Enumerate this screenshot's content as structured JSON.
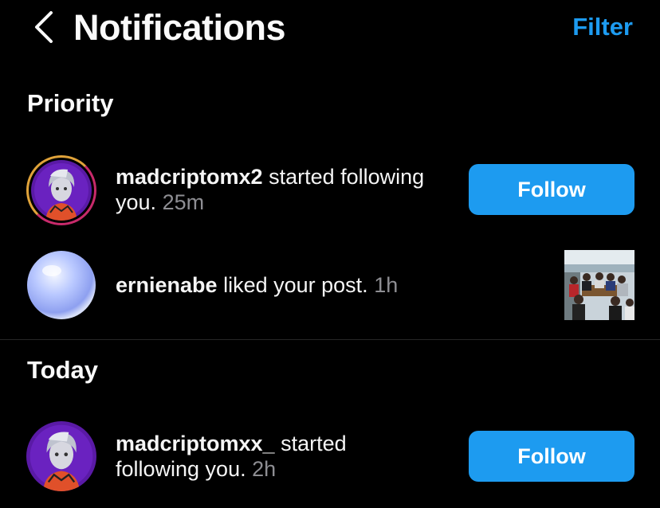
{
  "header": {
    "title": "Notifications",
    "filter_label": "Filter"
  },
  "sections": {
    "priority": {
      "title": "Priority",
      "items": [
        {
          "username": "madcriptomx2",
          "action": "started following",
          "action_line2": "you.",
          "time": "25m",
          "button_label": "Follow"
        },
        {
          "username": "ernienabe",
          "action": "liked your post.",
          "time": "1h"
        }
      ]
    },
    "today": {
      "title": "Today",
      "items": [
        {
          "username": "madcriptomxx_",
          "action": "started",
          "action_line2": "following you.",
          "time": "2h",
          "button_label": "Follow"
        }
      ]
    }
  },
  "colors": {
    "accent": "#1d9bf0",
    "background": "#000000",
    "muted_text": "#8e8e93",
    "story_ring": "#c82a6b"
  }
}
